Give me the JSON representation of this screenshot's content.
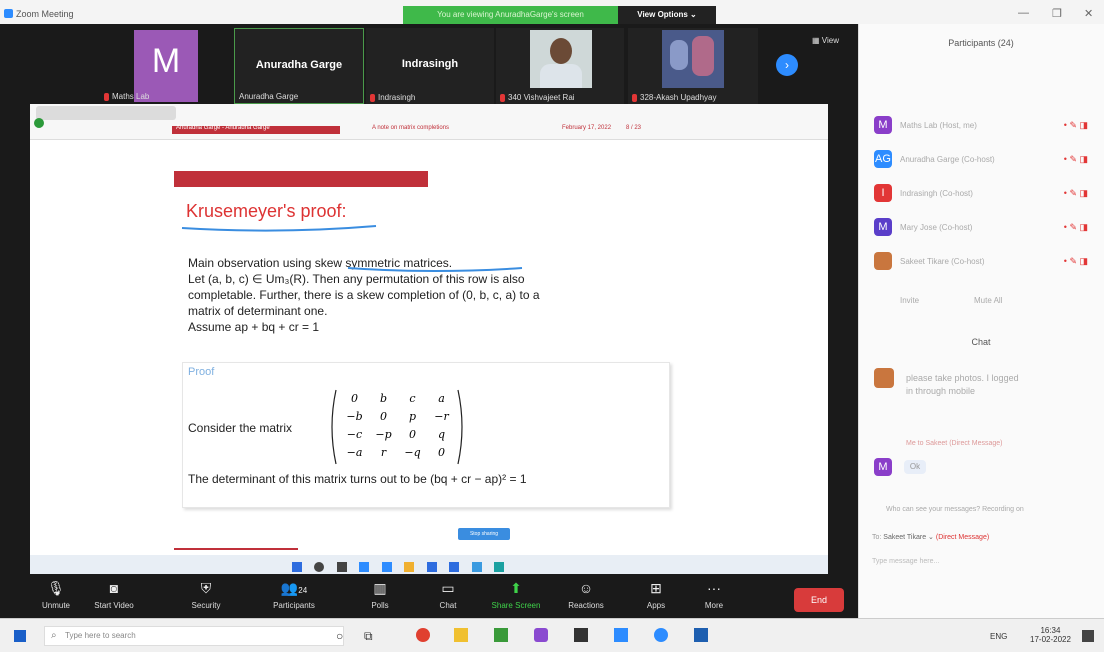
{
  "window": {
    "title": "Zoom Meeting"
  },
  "banner": {
    "viewing": "You are viewing AnuradhaGarge's screen",
    "view_options": "View Options ⌄"
  },
  "gallery": {
    "tiles": [
      {
        "avatar_letter": "M",
        "name": "",
        "sub": "Maths Lab"
      },
      {
        "name": "Anuradha Garge",
        "sub": "Anuradha Garge"
      },
      {
        "name": "Indrasingh",
        "sub": "Indrasingh"
      },
      {
        "name": "",
        "sub": "340 Vishvajeet Rai"
      },
      {
        "name": "",
        "sub": "328-Akash Upadhyay"
      }
    ],
    "view_label": "View"
  },
  "slide": {
    "header_left": "Anuradha Garge - Anuradha Garge",
    "header_mid": "A note on matrix completions",
    "header_date": "February 17, 2022",
    "header_page": "8 / 23",
    "title": "Krusemeyer's proof:",
    "line1_pre": "Main observation using ",
    "line1_link": "skew symmetric matrices.",
    "line2": "Let (a, b, c) ∈ Um₃(R). Then any permutation of this row is also",
    "line3": "completable. Further, there is a skew completion of (0, b, c, a) to a",
    "line4": "matrix of determinant one.",
    "line5": "Assume ap + bq + cr = 1",
    "proof_label": "Proof",
    "consider": "Consider the matrix",
    "matrix": [
      [
        "0",
        "b",
        "c",
        "a"
      ],
      [
        "−b",
        "0",
        "p",
        "−r"
      ],
      [
        "−c",
        "−p",
        "0",
        "q"
      ],
      [
        "−a",
        "r",
        "−q",
        "0"
      ]
    ],
    "determinant": "The determinant of this matrix turns out to be (bq + cr − ap)² = 1",
    "stop_share": "Stop sharing"
  },
  "toolbar": {
    "unmute": "Unmute",
    "start_video": "Start Video",
    "security": "Security",
    "participants": "Participants",
    "participants_count": "24",
    "polls": "Polls",
    "chat": "Chat",
    "share_screen": "Share Screen",
    "reactions": "Reactions",
    "apps": "Apps",
    "more": "More",
    "end": "End"
  },
  "panel": {
    "participants_title": "Participants (24)",
    "participants": [
      {
        "initials": "M",
        "color": "#8a3ec9",
        "name": "Maths Lab (Host, me)"
      },
      {
        "initials": "AG",
        "color": "#2d8cff",
        "name": "Anuradha Garge (Co-host)"
      },
      {
        "initials": "I",
        "color": "#e23636",
        "name": "Indrasingh (Co-host)"
      },
      {
        "initials": "M",
        "color": "#5a3ec9",
        "name": "Mary Jose (Co-host)"
      },
      {
        "initials": "",
        "color": "#c9763e",
        "name": "Sakeet Tikare (Co-host)"
      }
    ],
    "invite": "Invite",
    "mute_all": "Mute All",
    "chat_title": "Chat",
    "chat_msg": "please take photos. I logged in through mobile",
    "chat_meta": "Me to Sakeet (Direct Message)",
    "chat_reply": "Ok",
    "who_can_see": "Who can see your messages? Recording on",
    "to_label": "To:",
    "to_name": "Sakeet Tikare ⌄",
    "to_dm": "(Direct Message)",
    "input_placeholder": "Type message here..."
  },
  "taskbar": {
    "search_placeholder": "Type here to search",
    "lang": "ENG",
    "time": "16:34",
    "date": "17-02-2022"
  },
  "colors": {
    "banner_green": "#3fb94a",
    "end_red": "#d83b3b",
    "slide_red": "#c0303a",
    "accent_blue": "#2d8cff"
  }
}
